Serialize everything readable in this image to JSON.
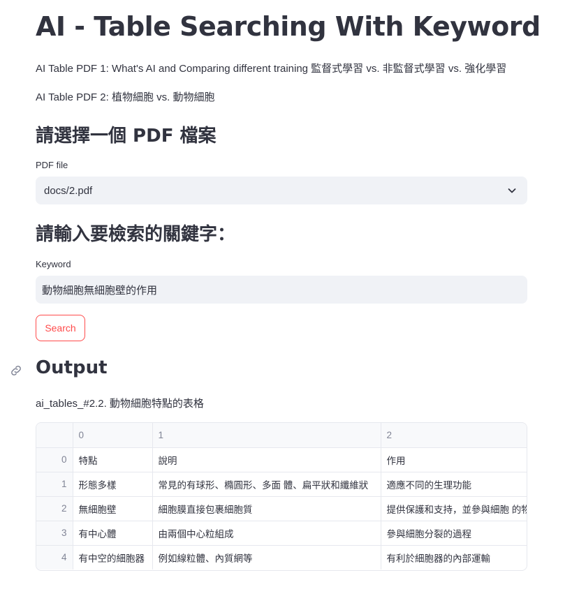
{
  "page": {
    "title": "AI - Table Searching With Keyword",
    "desc1": "AI Table PDF 1: What's AI and Comparing different training 監督式學習 vs. 非監督式學習 vs. 強化學習",
    "desc2": "AI Table PDF 2: 植物細胞 vs. 動物細胞"
  },
  "pdf_section": {
    "heading": "請選擇一個 PDF 檔案",
    "label": "PDF file",
    "selected": "docs/2.pdf"
  },
  "keyword_section": {
    "heading": "請輸入要檢索的關鍵字：",
    "label": "Keyword",
    "value": "動物細胞無細胞壁的作用",
    "button": "Search"
  },
  "output": {
    "heading": "Output",
    "caption": "ai_tables_#2.2. 動物細胞特點的表格",
    "columns": [
      "",
      "0",
      "1",
      "2"
    ],
    "rows": [
      {
        "idx": "0",
        "c0": "特點",
        "c1": "說明",
        "c2": "作用"
      },
      {
        "idx": "1",
        "c0": "形態多樣",
        "c1": "常見的有球形、橢圓形、多面 體、扁平狀和纖維狀",
        "c2": "適應不同的生理功能"
      },
      {
        "idx": "2",
        "c0": "無細胞壁",
        "c1": "細胞膜直接包裹細胞質",
        "c2": "提供保護和支持，並參與細胞 的物"
      },
      {
        "idx": "3",
        "c0": "有中心體",
        "c1": "由兩個中心粒組成",
        "c2": "參與細胞分裂的過程"
      },
      {
        "idx": "4",
        "c0": "有中空的細胞器",
        "c1": "例如線粒體、內質網等",
        "c2": "有利於細胞器的內部運輸"
      }
    ]
  },
  "colors": {
    "accent": "#ff4b4b",
    "input_bg": "#f0f2f6",
    "text": "#31333f"
  },
  "icons": {
    "anchor": "link-icon",
    "dropdown": "chevron-down-icon"
  }
}
